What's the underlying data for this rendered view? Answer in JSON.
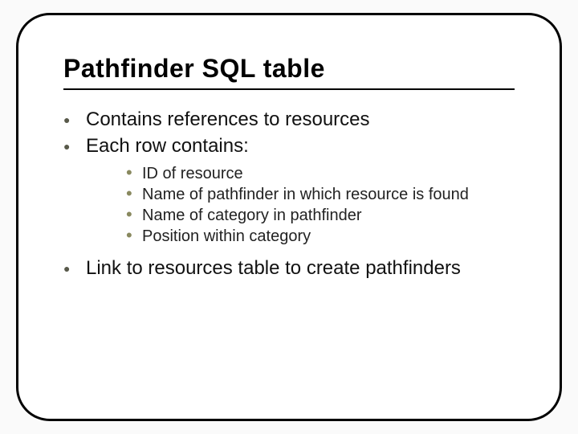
{
  "slide": {
    "title": "Pathfinder SQL table",
    "bullets": {
      "0": "Contains references to resources",
      "1": "Each row contains:",
      "2": "Link to resources table to create pathfinders"
    },
    "sub_bullets": {
      "0": "ID of resource",
      "1": "Name of pathfinder in which resource is found",
      "2": "Name of category in pathfinder",
      "3": "Position within category"
    }
  }
}
